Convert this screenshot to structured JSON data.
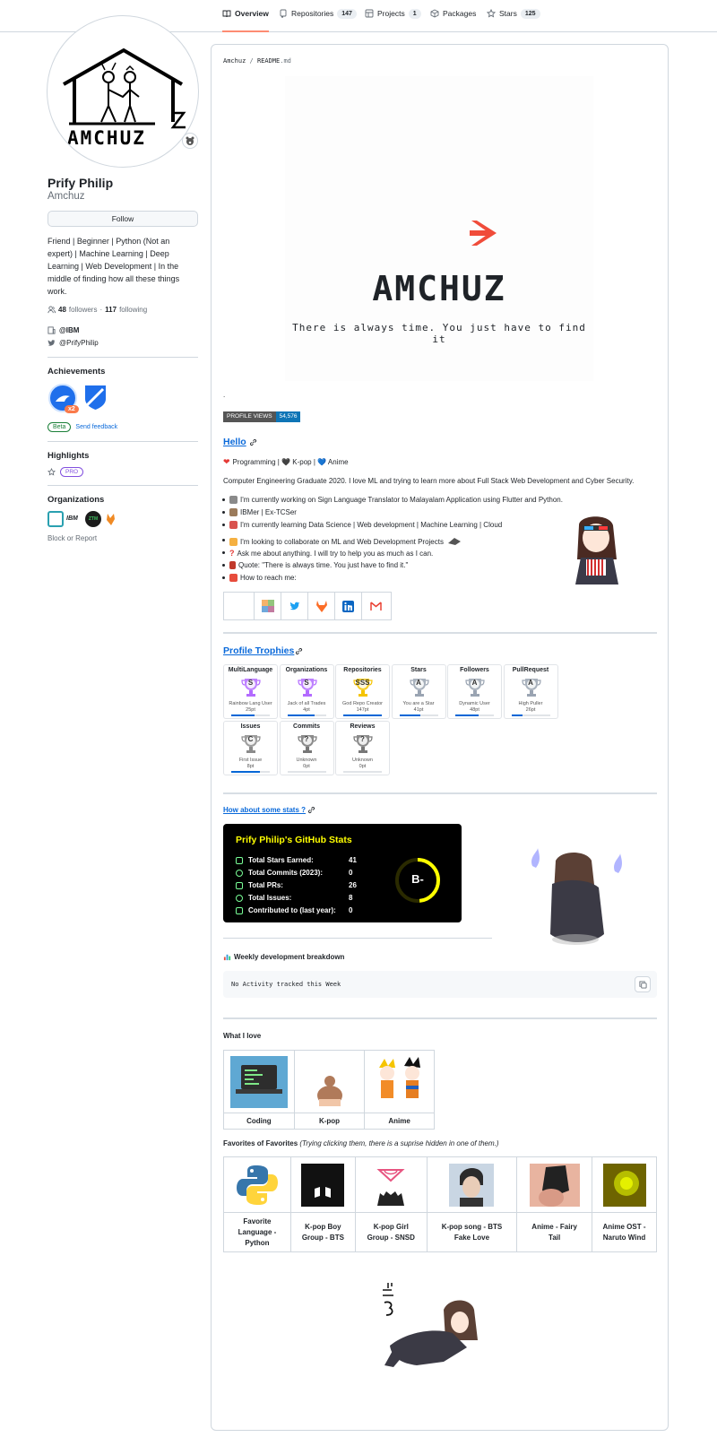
{
  "nav": {
    "tabs": [
      {
        "label": "Overview",
        "icon": "book-icon"
      },
      {
        "label": "Repositories",
        "count": "147",
        "icon": "repo-icon"
      },
      {
        "label": "Projects",
        "count": "1",
        "icon": "table-icon"
      },
      {
        "label": "Packages",
        "icon": "package-icon"
      },
      {
        "label": "Stars",
        "count": "125",
        "icon": "star-icon"
      }
    ]
  },
  "profile": {
    "avatar_text": "AMCHUZ",
    "name": "Prify Philip",
    "username": "Amchuz",
    "follow_label": "Follow",
    "bio": "Friend | Beginner | Python (Not an expert) | Machine Learning | Deep Learning | Web Development | In the middle of finding how all these things work.",
    "followers_count": "48",
    "followers_label": "followers",
    "following_count": "117",
    "following_label": "following",
    "separator": "·",
    "company": "@IBM",
    "twitter": "@PrifyPhilip"
  },
  "achievements": {
    "title": "Achievements",
    "badge_x2": "x2",
    "beta": "Beta",
    "feedback": "Send feedback"
  },
  "highlights": {
    "title": "Highlights",
    "pro": "PRO"
  },
  "organizations": {
    "title": "Organizations",
    "block_report": "Block or Report",
    "ibm": "IBM",
    "ztm": "ZTM"
  },
  "readme": {
    "path_user": "Amchuz",
    "path_sep": "/",
    "path_file": "README",
    "path_ext": ".md",
    "banner_title": "AMCHUZ",
    "banner_tagline": "There is always time. You just have to find it",
    "dot": ".",
    "views_label": "PROFILE VIEWS",
    "views_count": "54,576",
    "hello": "Hello",
    "interests": "Programming | 🖤 K-pop | 💙 Anime",
    "about": "Computer Engineering Graduate 2020. I love ML and trying to learn more about Full Stack Web Development and Cyber Security.",
    "bullets": [
      "I'm currently working on Sign Language Translator to Malayalam Application using Flutter and Python.",
      "IBMer | Ex-TCSer",
      "I'm currently learning Data Science | Web development | Machine Learning | Cloud",
      "I'm looking to collaborate on ML and Web Development Projects",
      "Ask me about anything. I will try to help you as much as I can.",
      "Quote: \"There is always time. You just have to find it.\"",
      "How to reach me:"
    ]
  },
  "trophies": {
    "title": "Profile Trophies",
    "items": [
      {
        "title": "MultiLanguage",
        "rank": "S",
        "name": "Rainbow Lang User",
        "pts": "25pt",
        "level": 0.6
      },
      {
        "title": "Organizations",
        "rank": "S",
        "name": "Jack of all Trades",
        "pts": "4pt",
        "level": 0.7
      },
      {
        "title": "Repositories",
        "rank": "SSS",
        "name": "God Repo Creator",
        "pts": "147pt",
        "level": 1.0
      },
      {
        "title": "Stars",
        "rank": "A",
        "name": "You are a Star",
        "pts": "41pt",
        "level": 0.55
      },
      {
        "title": "Followers",
        "rank": "A",
        "name": "Dynamic User",
        "pts": "48pt",
        "level": 0.6
      },
      {
        "title": "PullRequest",
        "rank": "A",
        "name": "High Puller",
        "pts": "26pt",
        "level": 0.3
      },
      {
        "title": "Issues",
        "rank": "C",
        "name": "First Issue",
        "pts": "8pt",
        "level": 0.75
      },
      {
        "title": "Commits",
        "rank": "?",
        "name": "Unknown",
        "pts": "0pt",
        "level": 0
      },
      {
        "title": "Reviews",
        "rank": "?",
        "name": "Unknown",
        "pts": "0pt",
        "level": 0
      }
    ]
  },
  "stats": {
    "heading": "How about some stats ?",
    "card_title": "Prify Philip's GitHub Stats",
    "rows": [
      {
        "label": "Total Stars Earned:",
        "value": "41"
      },
      {
        "label": "Total Commits (2023):",
        "value": "0"
      },
      {
        "label": "Total PRs:",
        "value": "26"
      },
      {
        "label": "Total Issues:",
        "value": "8"
      },
      {
        "label": "Contributed to (last year):",
        "value": "0"
      }
    ],
    "grade": "B-",
    "weekly_title": "Weekly development breakdown",
    "weekly_text": "No Activity tracked this Week"
  },
  "love": {
    "title": "What I love",
    "items": [
      "Coding",
      "K-pop",
      "Anime"
    ]
  },
  "favorites": {
    "title": "Favorites of Favorites",
    "note": "(Trying clicking them, there is a suprise hidden in one of them.)",
    "items": [
      {
        "line1": "Favorite",
        "line2": "Language -",
        "line3": "Python"
      },
      {
        "line1": "K-pop Boy",
        "line2": "Group - BTS",
        "line3": ""
      },
      {
        "line1": "K-pop Girl",
        "line2": "Group - SNSD",
        "line3": ""
      },
      {
        "line1": "K-pop song - BTS",
        "line2": "Fake Love",
        "line3": ""
      },
      {
        "line1": "Anime - Fairy",
        "line2": "Tail",
        "line3": ""
      },
      {
        "line1": "Anime OST -",
        "line2": "Naruto Wind",
        "line3": ""
      }
    ]
  },
  "colors": {
    "accent": "#fd8c73",
    "link": "#0969da",
    "stats_bg": "#000000",
    "stats_title": "#ffff00",
    "stats_icon": "#79ff97"
  }
}
